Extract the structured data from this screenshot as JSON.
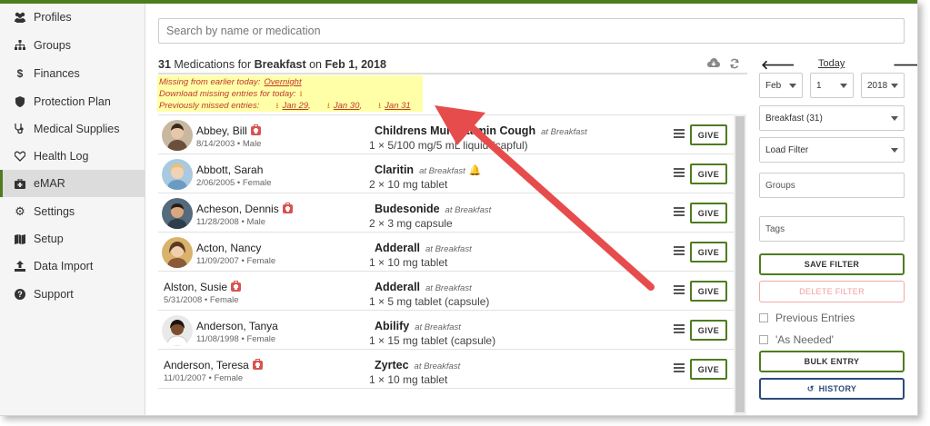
{
  "sidebar": {
    "items": [
      {
        "label": "Profiles",
        "icon": "users-icon"
      },
      {
        "label": "Groups",
        "icon": "sitemap-icon"
      },
      {
        "label": "Finances",
        "icon": "dollar-icon"
      },
      {
        "label": "Protection Plan",
        "icon": "shield-icon"
      },
      {
        "label": "Medical Supplies",
        "icon": "stethoscope-icon"
      },
      {
        "label": "Health Log",
        "icon": "heartbeat-icon"
      },
      {
        "label": "eMAR",
        "icon": "medkit-icon",
        "active": true
      },
      {
        "label": "Settings",
        "icon": "gear-icon"
      },
      {
        "label": "Setup",
        "icon": "map-icon"
      },
      {
        "label": "Data Import",
        "icon": "upload-icon"
      },
      {
        "label": "Support",
        "icon": "question-circle-icon"
      }
    ]
  },
  "search": {
    "placeholder": "Search by name or medication"
  },
  "header": {
    "count": "31",
    "text1": "Medications for",
    "meal": "Breakfast",
    "on": "on",
    "date": "Feb 1, 2018"
  },
  "missing": {
    "earlier_label": "Missing from earlier today:",
    "earlier_link": "Overnight",
    "download_label": "Download missing entries for today:",
    "previous_label": "Previously missed entries:",
    "previous_dates": [
      "Jan 29",
      "Jan 30",
      "Jan 31"
    ]
  },
  "patients": [
    {
      "name": "Abbey, Bill",
      "meta": "8/14/2003 • Male",
      "medkit": true,
      "avatar": true,
      "med": "Childrens Multivitamin Cough",
      "at": "at Breakfast",
      "dose": "1 × 5/100 mg/5 mL liquid (capful)",
      "bell": false
    },
    {
      "name": "Abbott, Sarah",
      "meta": "2/06/2005 • Female",
      "medkit": false,
      "avatar": true,
      "med": "Claritin",
      "at": "at Breakfast",
      "dose": "2 × 10 mg tablet",
      "bell": true
    },
    {
      "name": "Acheson, Dennis",
      "meta": "11/28/2008 • Male",
      "medkit": true,
      "avatar": true,
      "med": "Budesonide",
      "at": "at Breakfast",
      "dose": "2 × 3 mg capsule",
      "bell": false
    },
    {
      "name": "Acton, Nancy",
      "meta": "11/09/2007 • Female",
      "medkit": false,
      "avatar": true,
      "med": "Adderall",
      "at": "at Breakfast",
      "dose": "1 × 10 mg tablet",
      "bell": false
    },
    {
      "name": "Alston, Susie",
      "meta": "5/31/2008 • Female",
      "medkit": true,
      "avatar": false,
      "med": "Adderall",
      "at": "at Breakfast",
      "dose": "1 × 5 mg tablet (capsule)",
      "bell": false
    },
    {
      "name": "Anderson, Tanya",
      "meta": "11/08/1998 • Female",
      "medkit": false,
      "avatar": true,
      "med": "Abilify",
      "at": "at Breakfast",
      "dose": "1 × 15 mg tablet (capsule)",
      "bell": false
    },
    {
      "name": "Anderson, Teresa",
      "meta": "11/01/2007 • Female",
      "medkit": true,
      "avatar": false,
      "med": "Zyrtec",
      "at": "at Breakfast",
      "dose": "1 × 10 mg tablet",
      "bell": false
    }
  ],
  "give_label": "GIVE",
  "right": {
    "today": "Today",
    "month": "Feb",
    "day": "1",
    "year": "2018",
    "meal_select": "Breakfast (31)",
    "filter_select": "Load Filter",
    "groups_placeholder": "Groups",
    "tags_placeholder": "Tags",
    "save_filter": "SAVE FILTER",
    "delete_filter": "DELETE FILTER",
    "previous_entries": "Previous Entries",
    "as_needed": "'As Needed'",
    "bulk_entry": "BULK ENTRY",
    "history": "HISTORY"
  },
  "colors": {
    "accent": "#4e7c1f",
    "warning_bg": "#ffffa8",
    "warning_text": "#c0392b",
    "arrow": "#e74c4c"
  }
}
